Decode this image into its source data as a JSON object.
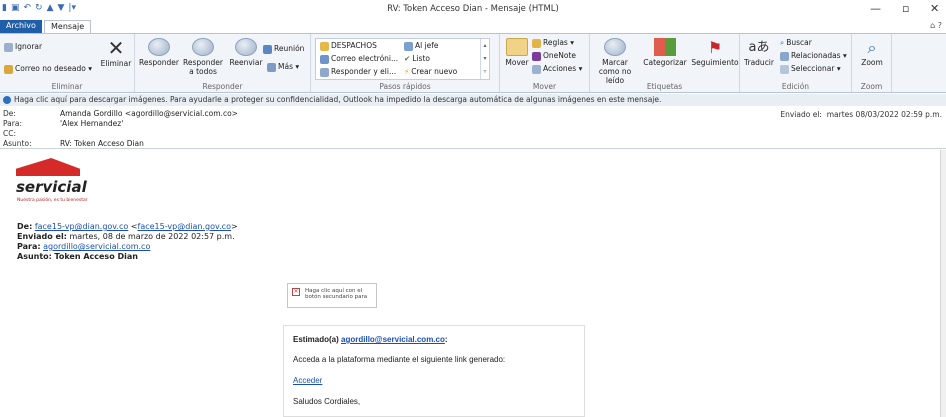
{
  "window": {
    "title": "RV: Token Acceso Dian  -  Mensaje (HTML)",
    "minimize_icon": "minimize-icon",
    "restore_icon": "restore-icon",
    "close_icon": "close-icon"
  },
  "tabs": {
    "file": "Archivo",
    "message": "Mensaje"
  },
  "ribbon": {
    "delete_group": {
      "ignore": "Ignorar",
      "junk": "Correo no deseado",
      "delete": "Eliminar",
      "label": "Eliminar"
    },
    "respond_group": {
      "reply": "Responder",
      "reply_all": "Responder a todos",
      "forward": "Reenviar",
      "meeting": "Reunión",
      "more": "Más",
      "label": "Responder"
    },
    "quick_steps": {
      "items": [
        "DESPACHOS",
        "Al jefe",
        "Correo electróni...",
        "Listo",
        "Responder y eli...",
        "Crear nuevo"
      ],
      "label": "Pasos rápidos"
    },
    "move_group": {
      "move": "Mover",
      "rules": "Reglas",
      "onenote": "OneNote",
      "actions": "Acciones",
      "label": "Mover"
    },
    "tags_group": {
      "mark_unread": "Marcar como no leído",
      "categorize": "Categorizar",
      "follow_up": "Seguimiento",
      "label": "Etiquetas"
    },
    "edit_group": {
      "translate": "Traducir",
      "find": "Buscar",
      "related": "Relacionadas",
      "select": "Seleccionar",
      "label": "Edición"
    },
    "zoom_group": {
      "zoom": "Zoom",
      "label": "Zoom"
    }
  },
  "infobar": "Haga clic aquí para descargar imágenes. Para ayudarle a proteger su confidencialidad, Outlook ha impedido la descarga automática de algunas imágenes en este mensaje.",
  "headers": {
    "from_label": "De:",
    "from_value": "Amanda Gordillo <agordillo@servicial.com.co>",
    "to_label": "Para:",
    "to_value": "'Alex Hernandez'",
    "cc_label": "CC:",
    "cc_value": "",
    "subject_label": "Asunto:",
    "subject_value": "RV: Token Acceso Dian",
    "sent_label": "Enviado el:",
    "sent_value": "martes 08/03/2022 02:59 p.m."
  },
  "logo": {
    "name": "servicial",
    "tagline": "Nuestra pasión, es tu bienestar"
  },
  "forwarded": {
    "from_label": "De:",
    "from_link1": "face15-vp@dian.gov.co",
    "from_link2": "face15-vp@dian.gov.co",
    "sent_label": "Enviado el:",
    "sent_value": "martes, 08 de marzo de 2022 02:57 p.m.",
    "to_label": "Para:",
    "to_link": "agordillo@servicial.com.co",
    "subject_label": "Asunto:",
    "subject_value": "Token Acceso Dian"
  },
  "image_placeholder": "Haga clic aquí con el botón secundario para",
  "card": {
    "greeting": "Estimado(a)",
    "greeting_link": "agordillo@servicial.com.co",
    "line1": "Acceda a la plataforma mediante el siguiente link generado:",
    "link": "Acceder",
    "closing": "Saludos Cordiales,"
  },
  "colors": {
    "accent": "#1f5ea8",
    "link": "#1a4fb3",
    "brand_red": "#d42a2a"
  }
}
